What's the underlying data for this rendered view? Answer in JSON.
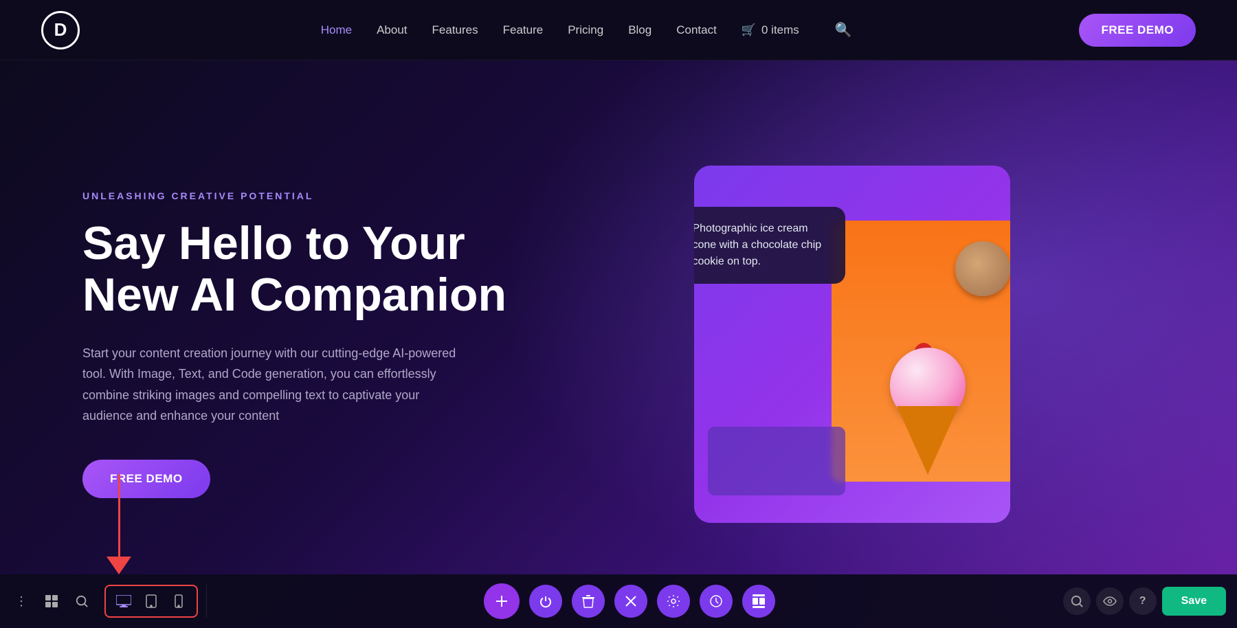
{
  "logo": {
    "letter": "D"
  },
  "navbar": {
    "links": [
      {
        "label": "Home",
        "active": true
      },
      {
        "label": "About"
      },
      {
        "label": "Features"
      },
      {
        "label": "Feature"
      },
      {
        "label": "Pricing"
      },
      {
        "label": "Blog"
      },
      {
        "label": "Contact"
      }
    ],
    "cart_label": "0 items",
    "demo_btn": "FREE DEMO"
  },
  "hero": {
    "eyebrow": "UNLEASHING CREATIVE POTENTIAL",
    "title": "Say Hello to Your New AI Companion",
    "description": "Start your content creation journey with our cutting-edge AI-powered tool. With Image, Text, and Code generation, you can effortlessly combine striking images and compelling text to captivate your audience and enhance your content",
    "cta_label": "FREE DEMO"
  },
  "ai_tooltip": {
    "text": "Photographic ice cream cone with a chocolate chip cookie on top."
  },
  "toolbar": {
    "left_icons": [
      "⋮",
      "⊞"
    ],
    "search_icon": "🔍",
    "device_icons": [
      "🖥",
      "▭",
      "📱"
    ],
    "center_buttons": [
      "+",
      "⏻",
      "🗑",
      "✕",
      "⚙",
      "⏱",
      "⇅"
    ],
    "right_icons": [
      "🔍",
      "👁",
      "?"
    ],
    "save_label": "Save"
  }
}
